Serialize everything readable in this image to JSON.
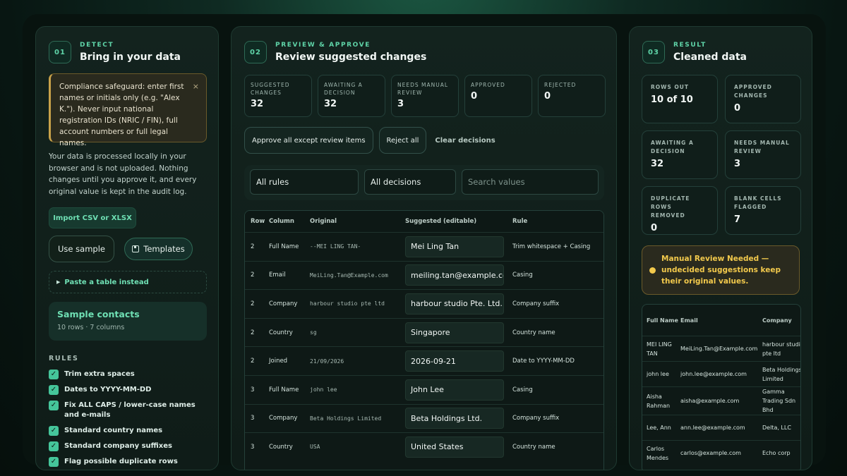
{
  "detect": {
    "step": "01",
    "label": "DETECT",
    "title": "Bring in your data",
    "warning": "Compliance safeguard: enter first names or initials only (e.g. \"Alex K.\"). Never input national registration IDs (NRIC / FIN), full account numbers or full legal names.",
    "warning_close": "×",
    "description": "Your data is processed locally in your browser and is not uploaded. Nothing changes until you approve it, and every original value is kept in the audit log.",
    "import_label": "Import CSV or XLSX",
    "sample_label": "Use sample",
    "templates_label": "Templates",
    "paste_label": "Paste a table instead",
    "sample_title": "Sample contacts",
    "sample_sub": "10 rows · 7 columns",
    "rules_heading": "RULES",
    "rules": [
      "Trim extra spaces",
      "Dates to YYYY-MM-DD",
      "Fix ALL CAPS / lower-case names and e-mails",
      "Standard country names",
      "Standard company suffixes",
      "Flag possible duplicate rows"
    ]
  },
  "preview": {
    "step": "02",
    "label": "PREVIEW & APPROVE",
    "title": "Review suggested changes",
    "stats": [
      {
        "label": "SUGGESTED CHANGES",
        "value": "32"
      },
      {
        "label": "AWAITING A DECISION",
        "value": "32"
      },
      {
        "label": "NEEDS MANUAL REVIEW",
        "value": "3"
      },
      {
        "label": "APPROVED",
        "value": "0"
      },
      {
        "label": "REJECTED",
        "value": "0"
      }
    ],
    "approve_label": "Approve all except review items",
    "reject_label": "Reject all",
    "clear_label": "Clear decisions",
    "filter_rules": "All rules",
    "filter_decisions": "All decisions",
    "search_placeholder": "Search values",
    "columns": [
      "Row",
      "Column",
      "Original",
      "Suggested (editable)",
      "Rule"
    ],
    "rows": [
      {
        "row": "2",
        "column": "Full Name",
        "original": "--MEI LING TAN-",
        "suggested": "Mei Ling Tan",
        "rule": "Trim whitespace + Casing"
      },
      {
        "row": "2",
        "column": "Email",
        "original": "MeiLing.Tan@Example.com",
        "suggested": "meiling.tan@example.com",
        "rule": "Casing"
      },
      {
        "row": "2",
        "column": "Company",
        "original": "harbour studio pte ltd",
        "suggested": "harbour studio Pte. Ltd.",
        "rule": "Company suffix"
      },
      {
        "row": "2",
        "column": "Country",
        "original": "sg",
        "suggested": "Singapore",
        "rule": "Country name"
      },
      {
        "row": "2",
        "column": "Joined",
        "original": "21/09/2026",
        "suggested": "2026-09-21",
        "rule": "Date to YYYY-MM-DD"
      },
      {
        "row": "3",
        "column": "Full Name",
        "original": "john lee",
        "suggested": "John Lee",
        "rule": "Casing"
      },
      {
        "row": "3",
        "column": "Company",
        "original": "Beta Holdings Limited",
        "suggested": "Beta Holdings Ltd.",
        "rule": "Company suffix"
      },
      {
        "row": "3",
        "column": "Country",
        "original": "USA",
        "suggested": "United States",
        "rule": "Country name"
      }
    ]
  },
  "result": {
    "step": "03",
    "label": "RESULT",
    "title": "Cleaned data",
    "stats": [
      {
        "label": "ROWS OUT",
        "value": "10 of 10"
      },
      {
        "label": "APPROVED CHANGES",
        "value": "0"
      },
      {
        "label": "AWAITING A DECISION",
        "value": "32"
      },
      {
        "label": "NEEDS MANUAL REVIEW",
        "value": "3"
      },
      {
        "label": "DUPLICATE ROWS REMOVED",
        "value": "0"
      },
      {
        "label": "BLANK CELLS FLAGGED",
        "value": "7"
      }
    ],
    "manual_text": "Manual Review Needed — undecided suggestions keep their original values.",
    "columns": [
      "Full Name",
      "Email",
      "Company"
    ],
    "rows": [
      {
        "name": "MEI LING TAN",
        "email": "MeiLing.Tan@Example.com",
        "company": "harbour studio pte ltd"
      },
      {
        "name": "john lee",
        "email": "john.lee@example.com",
        "company": "Beta Holdings Limited"
      },
      {
        "name": "Aisha Rahman",
        "email": "aisha@example.com",
        "company": "Gamma Trading Sdn Bhd"
      },
      {
        "name": "Lee, Ann",
        "email": "ann.lee@example.com",
        "company": "Delta, LLC"
      },
      {
        "name": "Carlos Mendes",
        "email": "carlos@example.com",
        "company": "Echo corp"
      }
    ]
  }
}
